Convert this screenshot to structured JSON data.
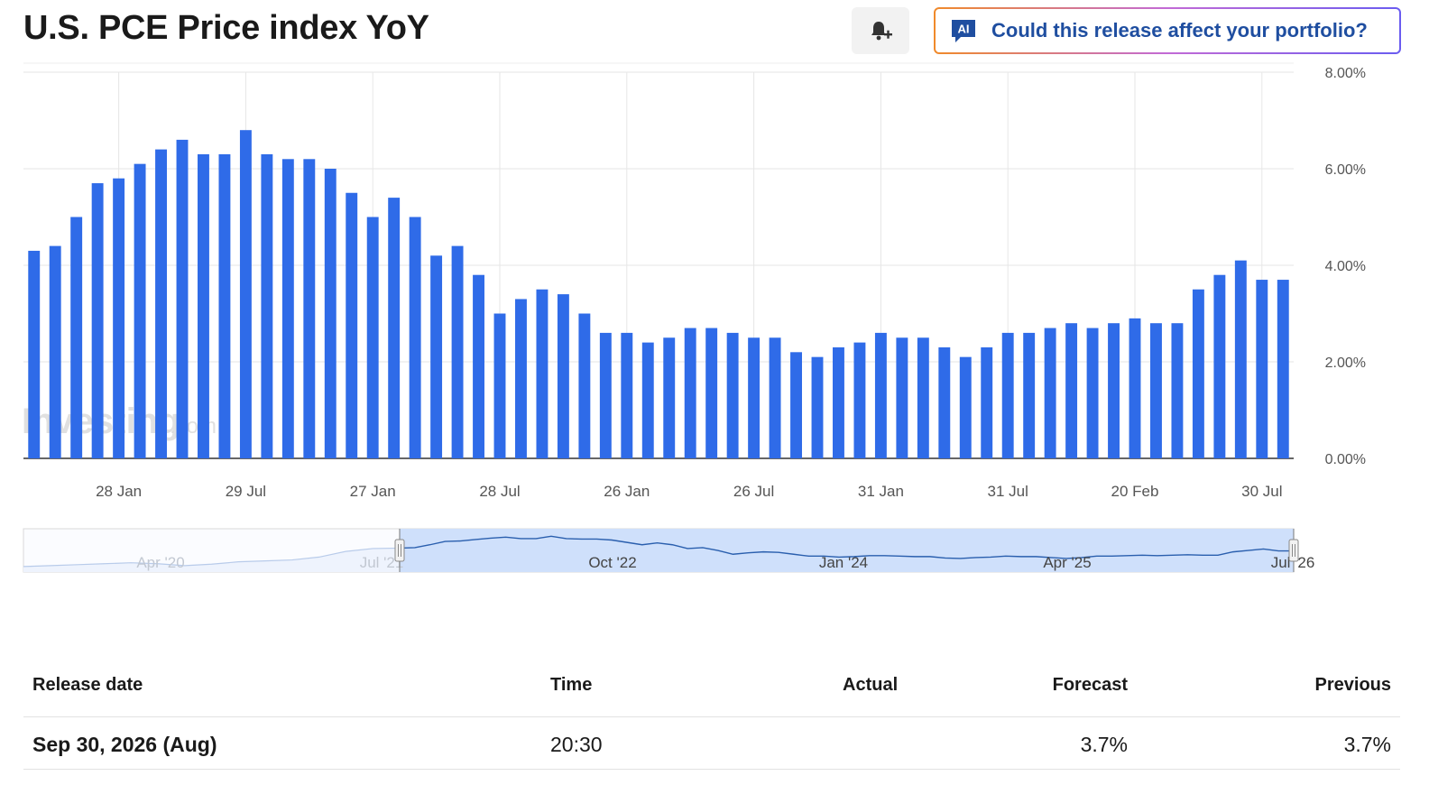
{
  "page": {
    "title": "U.S. PCE Price index YoY",
    "ai_button_label": "Could this release affect your portfolio?",
    "ai_badge": "AI",
    "watermark": "Investing",
    "watermark_suffix": ".com",
    "icons": {
      "alert": "bell-plus-icon",
      "ai": "ai-chat-icon"
    }
  },
  "chart_data": {
    "type": "bar",
    "title": "U.S. PCE Price index YoY",
    "xlabel": "",
    "ylabel": "",
    "ylim": [
      0,
      8
    ],
    "yticks": [
      "8.00%",
      "6.00%",
      "4.00%",
      "2.00%",
      "0.00%"
    ],
    "ytick_values": [
      8,
      6,
      4,
      2,
      0
    ],
    "x_tick_labels": [
      "28 Jan",
      "29 Jul",
      "27 Jan",
      "28 Jul",
      "26 Jan",
      "26 Jul",
      "31 Jan",
      "31 Jul",
      "20 Feb",
      "30 Jul"
    ],
    "x_tick_bar_index": [
      4.5,
      10.5,
      16.5,
      22.5,
      28.5,
      34.5,
      40.5,
      46.5,
      52.5,
      58.5
    ],
    "grid": true,
    "color": "#2f6be8",
    "values": [
      4.3,
      4.4,
      5.0,
      5.7,
      5.8,
      6.1,
      6.4,
      6.6,
      6.3,
      6.3,
      6.8,
      6.3,
      6.2,
      6.2,
      6.0,
      5.5,
      5.0,
      5.4,
      5.0,
      4.2,
      4.4,
      3.8,
      3.0,
      3.3,
      3.5,
      3.4,
      3.0,
      2.6,
      2.6,
      2.4,
      2.5,
      2.7,
      2.7,
      2.6,
      2.5,
      2.5,
      2.2,
      2.1,
      2.3,
      2.4,
      2.6,
      2.5,
      2.5,
      2.3,
      2.1,
      2.3,
      2.6,
      2.6,
      2.7,
      2.8,
      2.7,
      2.8,
      2.9,
      2.8,
      2.8,
      3.5,
      3.8,
      4.1,
      3.7,
      3.7
    ],
    "navigator": {
      "labels": [
        "Apr '20",
        "Jul '21",
        "Oct '22",
        "Jan '24",
        "Apr '25",
        "Jul '26"
      ]
    }
  },
  "table": {
    "headers": {
      "release_date": "Release date",
      "time": "Time",
      "actual": "Actual",
      "forecast": "Forecast",
      "previous": "Previous"
    },
    "rows": [
      {
        "release_date": "Sep 30, 2026 (Aug)",
        "time": "20:30",
        "actual": "",
        "forecast": "3.7%",
        "previous": "3.7%"
      }
    ]
  }
}
